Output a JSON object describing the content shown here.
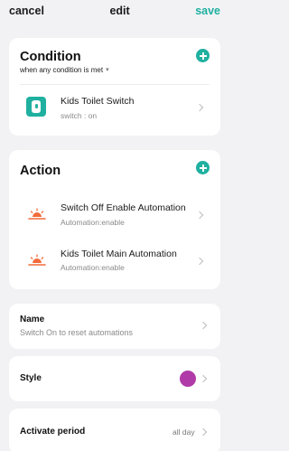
{
  "header": {
    "cancel_label": "cancel",
    "title": "edit",
    "save_label": "save"
  },
  "condition": {
    "title": "Condition",
    "mode_text": "when any condition is met",
    "items": [
      {
        "icon": "switch-device-icon",
        "title": "Kids Toilet Switch",
        "subtitle": "switch : on"
      }
    ]
  },
  "action": {
    "title": "Action",
    "items": [
      {
        "icon": "sunrise-icon",
        "title": "Switch Off Enable Automation",
        "subtitle": "Automation:enable"
      },
      {
        "icon": "sunrise-icon",
        "title": "Kids Toilet Main Automation",
        "subtitle": "Automation:enable"
      }
    ]
  },
  "name_section": {
    "label": "Name",
    "value": "Switch On to reset automations"
  },
  "style_section": {
    "label": "Style",
    "color": "#b03aa8"
  },
  "period_section": {
    "label": "Activate period",
    "value": "all day"
  },
  "colors": {
    "accent": "#1fb0a0",
    "sun_icon": "#f26b3a",
    "background": "#f2f2f5"
  }
}
